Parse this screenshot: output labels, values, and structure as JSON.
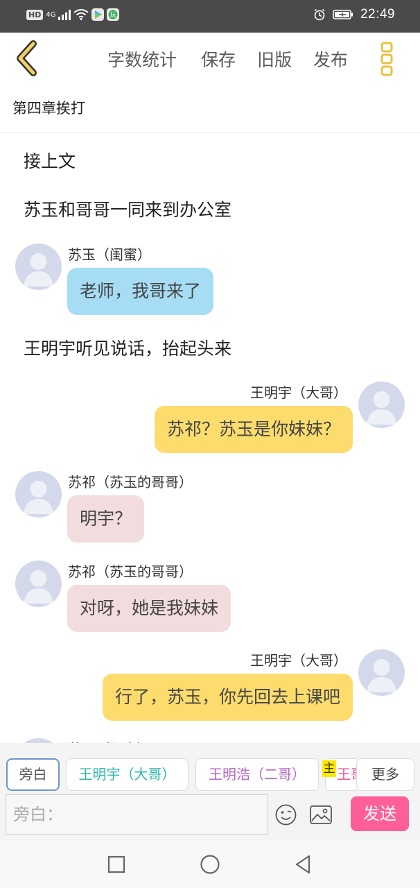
{
  "status_bar": {
    "hd": "HD",
    "network": "4G",
    "time": "22:49",
    "icons": [
      "signal-icon",
      "wifi-icon",
      "video-app-icon",
      "game-app-icon",
      "alarm-icon",
      "battery-icon"
    ]
  },
  "toolbar": {
    "word_count_label": "字数统计",
    "save_label": "保存",
    "old_version_label": "旧版",
    "publish_label": "发布",
    "accent_color": "#e8c13d"
  },
  "chapter": {
    "title": "第四章挨打"
  },
  "narrations": [
    "接上文",
    "苏玉和哥哥一同来到办公室",
    "王明宇听见说话，抬起头来"
  ],
  "messages": [
    {
      "speaker": "苏玉（闺蜜）",
      "text": "老师，我哥来了",
      "side": "left",
      "color": "#a6ddf5"
    },
    {
      "speaker": "王明宇（大哥）",
      "text": "苏祁？苏玉是你妹妹？",
      "side": "right",
      "color": "#fddc6e"
    },
    {
      "speaker": "苏祁（苏玉的哥哥）",
      "text": "明宇？",
      "side": "left",
      "color": "#f2dcdd"
    },
    {
      "speaker": "苏祁（苏玉的哥哥）",
      "text": "对呀，她是我妹妹",
      "side": "left",
      "color": "#f2dcdd"
    },
    {
      "speaker": "王明宇（大哥）",
      "text": "行了，苏玉，你先回去上课吧",
      "side": "right",
      "color": "#fddc6e"
    }
  ],
  "partial_speaker": "苏玉（闺蜜）",
  "role_chips": {
    "narration": "旁白",
    "brother1": "王明宇（大哥）",
    "brother2": "王明浩（二哥）",
    "brother3_partial": "王哥",
    "main_badge": "主",
    "more": "更多"
  },
  "input": {
    "placeholder": "旁白："
  },
  "send_label": "发送",
  "send_color": "#ff5f98"
}
